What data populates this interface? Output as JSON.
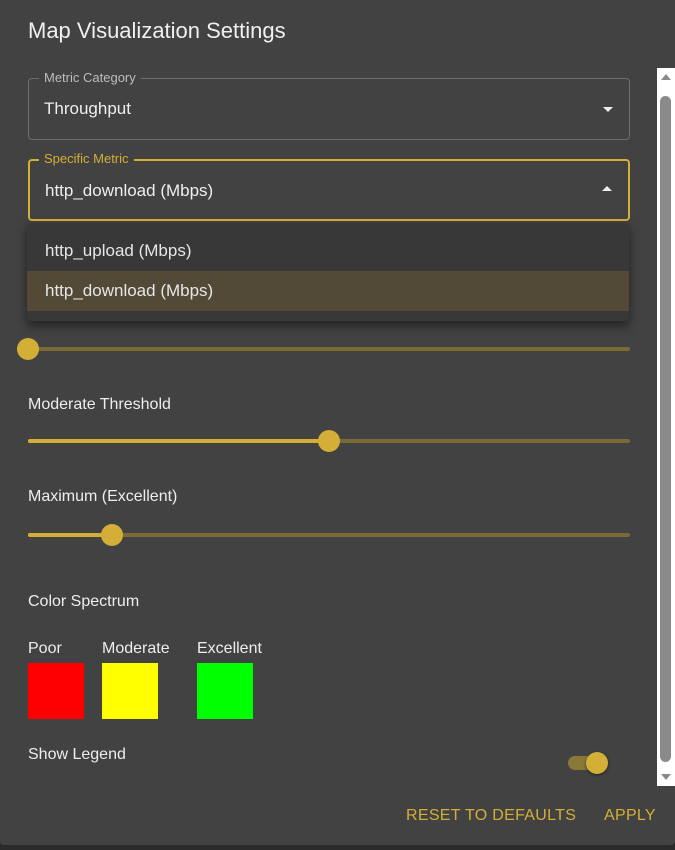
{
  "dialog": {
    "title": "Map Visualization Settings"
  },
  "metric_category": {
    "label": "Metric Category",
    "value": "Throughput"
  },
  "specific_metric": {
    "label": "Specific Metric",
    "value": "http_download (Mbps)",
    "options": [
      "http_upload (Mbps)",
      "http_download (Mbps)"
    ],
    "selected_index": 1
  },
  "sliders": [
    {
      "label": "",
      "value_pct": 0
    },
    {
      "label": "Moderate Threshold",
      "value_pct": 50
    },
    {
      "label": "Maximum (Excellent)",
      "value_pct": 14
    }
  ],
  "color_spectrum": {
    "title": "Color Spectrum",
    "swatches": [
      {
        "label": "Poor",
        "color": "#ff0000"
      },
      {
        "label": "Moderate",
        "color": "#ffff00"
      },
      {
        "label": "Excellent",
        "color": "#00ff00"
      }
    ]
  },
  "legend": {
    "label": "Show Legend",
    "on": true
  },
  "actions": {
    "reset": "RESET TO DEFAULTS",
    "apply": "APPLY"
  },
  "accent": "#d4af37"
}
